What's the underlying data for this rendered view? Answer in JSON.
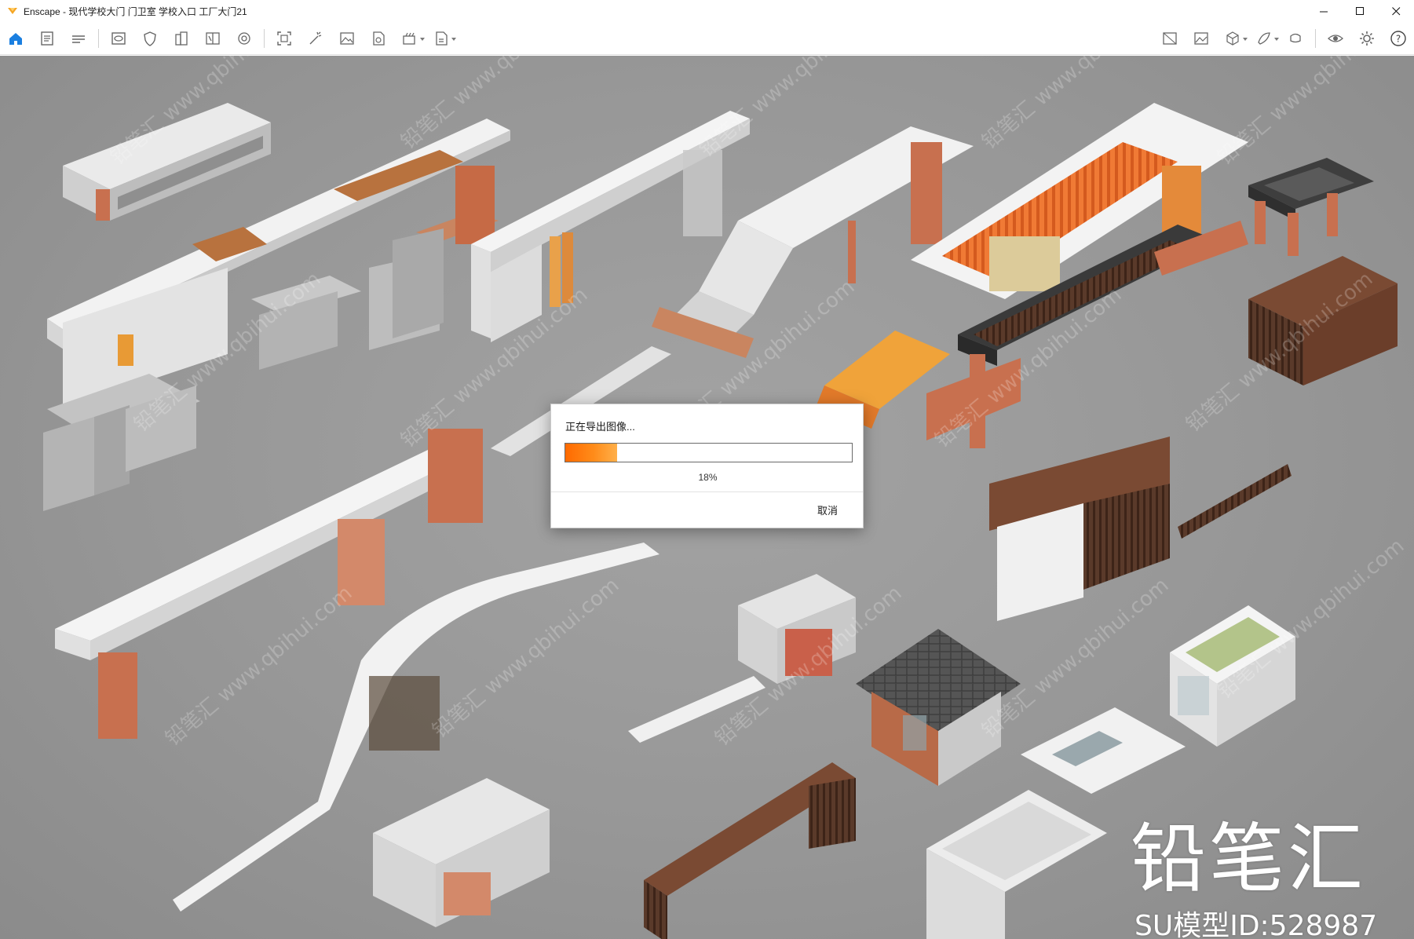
{
  "window": {
    "title": "Enscape - 现代学校大门 门卫室 学校入口 工厂大门21",
    "controls": [
      "minimize-icon",
      "maximize-icon",
      "close-icon"
    ]
  },
  "toolbar": {
    "left_icons": [
      "home-icon",
      "notes-icon",
      "bim-icon",
      "view-icon",
      "shield-icon",
      "building-icon",
      "compare-icon",
      "orbit-icon",
      "capture-icon",
      "spark-icon",
      "image-icon",
      "asset-icon",
      "batch-render-icon",
      "export-icon"
    ],
    "right_icons": [
      "visual-settings-icon",
      "image-settings-icon",
      "cube-icon",
      "material-icon",
      "vr-headset-icon",
      "eye-icon",
      "settings-icon",
      "help-icon"
    ],
    "collapse_icon": "chevron-up-icon",
    "accent_color": "#1a7fe0"
  },
  "viewport": {
    "background_color": "#999999",
    "content": "3D render of school gate and guard-house models"
  },
  "watermark": {
    "brand": "铅笔汇",
    "model_id": "SU模型ID:528987",
    "tile_text": "铅笔汇 www.qbihui.com"
  },
  "dialog": {
    "title": "正在导出图像...",
    "progress": 0.18,
    "progress_text": "18%",
    "cancel_label": "取消",
    "progress_color": "#ff7a10"
  }
}
